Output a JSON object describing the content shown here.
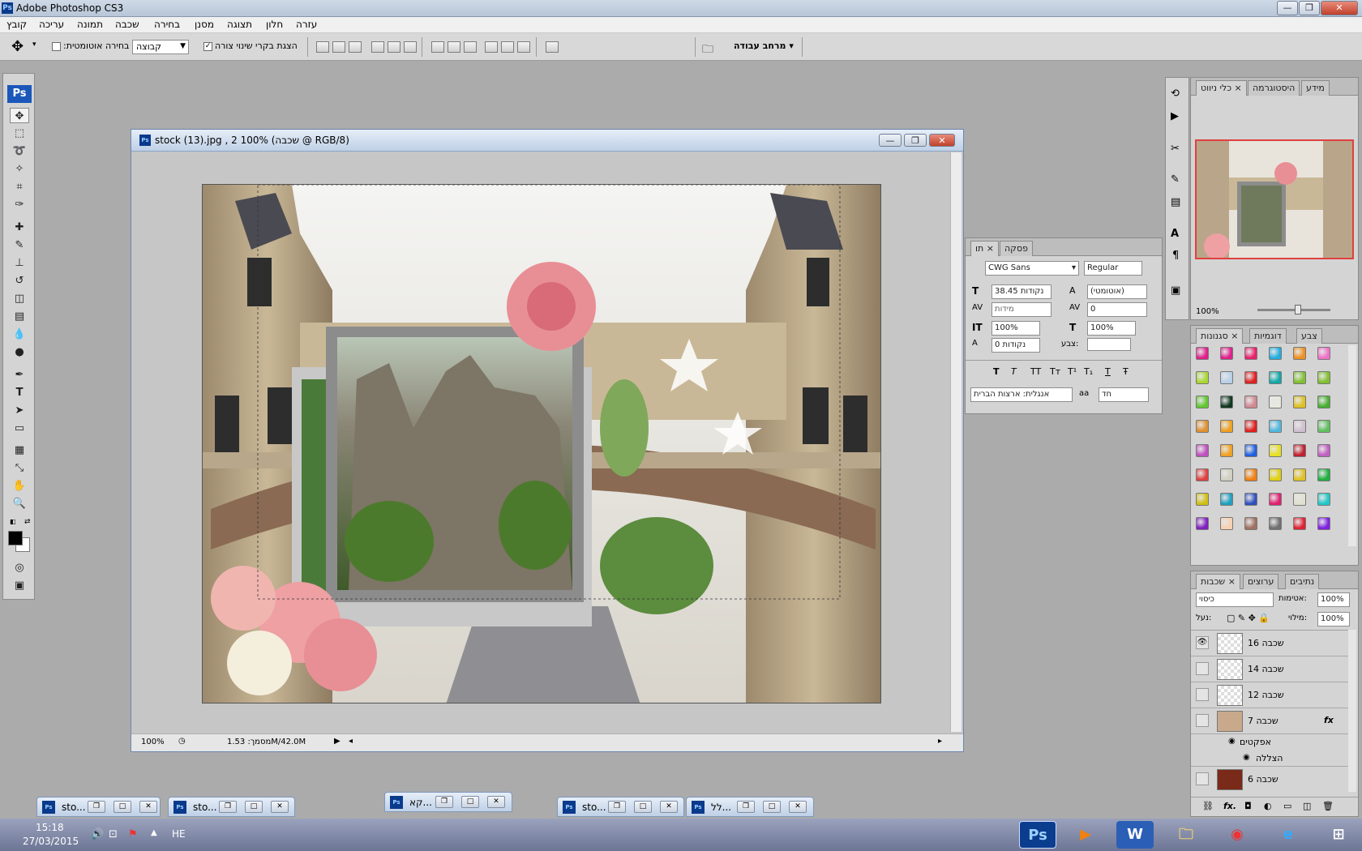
{
  "app": {
    "title": "Adobe Photoshop CS3",
    "logo": "Ps"
  },
  "window_controls": {
    "minimize": "—",
    "restore": "❐",
    "close": "✕"
  },
  "menu": [
    "קובץ",
    "עריכה",
    "תמונה",
    "שכבה",
    "בחירה",
    "מסנן",
    "תצוגה",
    "חלון",
    "עזרה"
  ],
  "options": {
    "auto_select_label": ":בחירה אוטומטית",
    "group_value": "קבוצה",
    "show_transform_label": "הצגת בקרי שינוי צורה",
    "workspace_label": "מרחב עבודה ▾"
  },
  "document": {
    "title": "stock (13).jpg , 2 שכבה) 100% @ RGB/8)",
    "zoom": "100%",
    "size_info": "מסמך: 1.53M/42.0M"
  },
  "navigator": {
    "tabs": [
      "כלי ניווט",
      "היסטוגרמה",
      "מידע"
    ],
    "zoom": "100%"
  },
  "character": {
    "tabs": [
      "תו",
      "פסקה"
    ],
    "font_family": "CWG Sans",
    "font_style": "Regular",
    "font_size": "38.45 נקודות",
    "leading": "(אוטומטי)",
    "kerning": "מידות",
    "tracking": "0",
    "vertical_scale": "100%",
    "horizontal_scale": "100%",
    "baseline": "0 נקודות",
    "color_label": "צבע:",
    "language": "אנגלית: ארצות הברית",
    "antialias": "חד",
    "style_buttons": [
      "T",
      "T",
      "TT",
      "Tт",
      "T¹",
      "T₁",
      "T",
      "Ŧ"
    ]
  },
  "styles": {
    "tabs": [
      "סגנונות",
      "דוגמיות",
      "צבע"
    ],
    "swatches": [
      "#e0208c",
      "#e0208c",
      "#e8206e",
      "#22aee0",
      "#f09020",
      "#f070c8",
      "#a8d830",
      "#b8d0e8",
      "#e02020",
      "#10a8a8",
      "#80c030",
      "#80c030",
      "#60c830",
      "#103820",
      "#d08890",
      "#e8e8e0",
      "#e0c020",
      "#48b030",
      "#e09030",
      "#f0a020",
      "#e02020",
      "#50b8e0",
      "#d0c0d0",
      "#60c060",
      "#c050c0",
      "#f0a020",
      "#2060e0",
      "#e8e020",
      "#c02030",
      "#c060c0",
      "#e04040",
      "#d0d0c0",
      "#f08010",
      "#e0d010",
      "#e0c020",
      "#20b040",
      "#d0c010",
      "#20a0c0",
      "#3050c0",
      "#e02070",
      "#e0e0d0",
      "#20c8c8",
      "#8020c0",
      "#f8d0b0",
      "#a07060",
      "#707070",
      "#e02030",
      "#8020e0"
    ]
  },
  "layers": {
    "tabs": [
      "שכבות",
      "ערוצים",
      "נתיבים"
    ],
    "blend_mode": "כיסוי",
    "opacity_label": "אטימות:",
    "opacity": "100%",
    "lock_label": "נעל:",
    "fill_label": "מילוי:",
    "fill": "100%",
    "items": [
      {
        "name": "שכבה 16",
        "visible": true
      },
      {
        "name": "שכבה 14",
        "visible": false
      },
      {
        "name": "שכבה 12",
        "visible": false
      },
      {
        "name": "שכבה 7",
        "visible": false,
        "fx": "fx"
      },
      {
        "name": "שכבה 6",
        "visible": false
      }
    ],
    "effects_label": "אפקטים",
    "effect_item": "הצללה"
  },
  "minimized": [
    {
      "title": "sto..."
    },
    {
      "title": "sto..."
    },
    {
      "title": "קא..."
    },
    {
      "title": "sto..."
    },
    {
      "title": "לל..."
    }
  ],
  "taskbar": {
    "time": "15:18",
    "date": "27/03/2015",
    "lang": "HE",
    "apps": [
      "Ps",
      "Media",
      "W",
      "Folder",
      "Chrome",
      "IE",
      "Win"
    ]
  }
}
